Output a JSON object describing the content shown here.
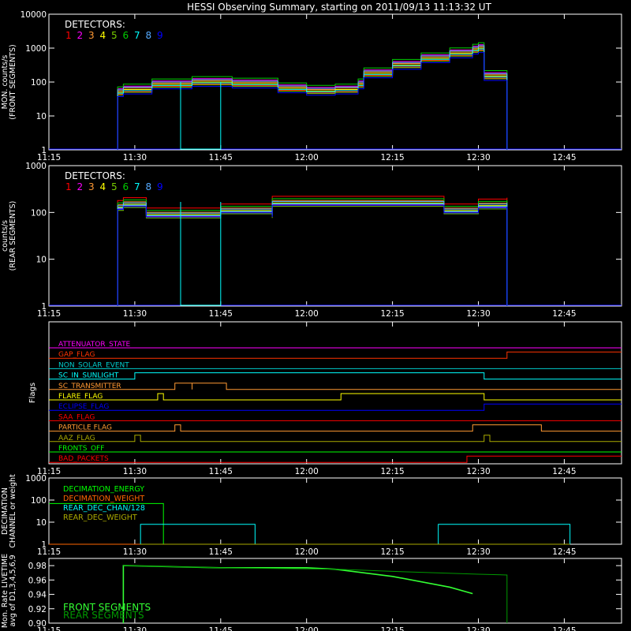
{
  "title": "HESSI Observing Summary, starting on 2011/09/13 11:13:32 UT",
  "colors": {
    "background": "#000000",
    "axis": "#ffffff",
    "detectors": [
      "#ff0000",
      "#ff00ff",
      "#ff9933",
      "#ffff00",
      "#77cc00",
      "#00cc00",
      "#00ffff",
      "#55aaff",
      "#0000ff"
    ]
  },
  "time_axis": {
    "start": "11:15",
    "end": "12:55",
    "ticks": [
      "11:15",
      "11:30",
      "11:45",
      "12:00",
      "12:15",
      "12:30",
      "12:45"
    ]
  },
  "detectors_label": "DETECTORS:",
  "detector_numbers": [
    "1",
    "2",
    "3",
    "4",
    "5",
    "6",
    "7",
    "8",
    "9"
  ],
  "chart_data": [
    {
      "panel": "front",
      "type": "line",
      "ylabel": "MON. counts/s (FRONT SEGMENTS)",
      "ylabel_lines": [
        "MON. counts/s",
        "(FRONT SEGMENTS)"
      ],
      "yscale": "log",
      "ylim": [
        1,
        10000
      ],
      "yticks": [
        "1",
        "10",
        "100",
        "1000",
        "10000"
      ],
      "envelope": {
        "x": [
          "11:27",
          "11:27",
          "11:28",
          "11:33",
          "11:40",
          "11:47",
          "11:55",
          "12:00",
          "12:05",
          "12:09",
          "12:10",
          "12:15",
          "12:20",
          "12:25",
          "12:29",
          "12:30",
          "12:31",
          "12:31",
          "12:35",
          "12:35"
        ],
        "y": [
          1,
          50,
          60,
          85,
          100,
          90,
          65,
          55,
          60,
          85,
          180,
          320,
          500,
          700,
          900,
          1000,
          1000,
          150,
          130,
          1
        ]
      },
      "detector_offsets": [
        -0.06,
        0.1,
        0.04,
        0.0,
        -0.08,
        0.16,
        -0.03,
        0.07,
        -0.13
      ],
      "detector7_gap": [
        "11:38",
        "11:45"
      ]
    },
    {
      "panel": "rear",
      "type": "line",
      "ylabel": "counts/s (REAR SEGMENTS)",
      "ylabel_lines": [
        "counts/s",
        "(REAR SEGMENTS)"
      ],
      "yscale": "log",
      "ylim": [
        1,
        1000
      ],
      "yticks": [
        "1",
        "10",
        "100",
        "1000"
      ],
      "envelope": {
        "x": [
          "11:27",
          "11:27",
          "11:28",
          "11:32",
          "11:32",
          "11:45",
          "11:54",
          "11:54",
          "12:24",
          "12:24",
          "12:30",
          "12:35",
          "12:35"
        ],
        "y": [
          1,
          130,
          150,
          140,
          90,
          110,
          90,
          160,
          160,
          110,
          140,
          150,
          1
        ]
      },
      "detector_offsets": [
        0.14,
        -0.03,
        0.05,
        0.0,
        -0.07,
        0.09,
        -0.02,
        0.03,
        -0.05
      ],
      "detector7_gap": [
        "11:38",
        "11:45"
      ]
    },
    {
      "panel": "flags",
      "type": "line",
      "ylabel": "Flags",
      "flags": [
        {
          "label": "ATTENUATOR_STATE",
          "color": "#ff00ff",
          "transitions": []
        },
        {
          "label": "SAA_FLAG_GAP_FLAG",
          "display": "GAP_FLAG",
          "color": "#ff3300",
          "transitions": [
            [
              "12:35",
              1
            ]
          ]
        },
        {
          "label": "NON_SOLAR_EVENT",
          "color": "#00cccc",
          "transitions": []
        },
        {
          "label": "SC_IN_SUNLIGHT",
          "color": "#00ffff",
          "transitions": [
            [
              "11:30",
              1
            ],
            [
              "12:31",
              0
            ]
          ]
        },
        {
          "label": "SC_TRANSMITTER",
          "color": "#ff9933",
          "transitions": [
            [
              "11:37",
              1
            ],
            [
              "11:40",
              0
            ],
            [
              "11:40",
              1
            ],
            [
              "11:46",
              0
            ]
          ]
        },
        {
          "label": "FLARE_FLAG",
          "color": "#ffff00",
          "transitions": [
            [
              "11:34",
              1
            ],
            [
              "11:35",
              0
            ],
            [
              "12:06",
              1
            ],
            [
              "12:31",
              0
            ]
          ]
        },
        {
          "label": "ECLIPSE_FLAG",
          "color": "#0000ff",
          "transitions": [
            [
              "11:30",
              0
            ],
            [
              "12:31",
              1
            ]
          ]
        },
        {
          "label": "SAA_FLAG",
          "color": "#ff0000",
          "transitions": []
        },
        {
          "label": "PARTICLE FLAG",
          "color": "#ff9933",
          "transitions": [
            [
              "11:37",
              1
            ],
            [
              "11:38",
              0
            ],
            [
              "12:29",
              1
            ],
            [
              "12:41",
              0
            ]
          ]
        },
        {
          "label": "AAZ_FLAG",
          "color": "#aaaa00",
          "transitions": [
            [
              "11:30",
              1
            ],
            [
              "11:31",
              0
            ],
            [
              "12:31",
              1
            ],
            [
              "12:32",
              0
            ]
          ]
        },
        {
          "label": "FRONTS_OFF",
          "color": "#00ff00",
          "transitions": []
        },
        {
          "label": "BAD_PACKETS",
          "color": "#ff0000",
          "transitions": [
            [
              "12:28",
              1
            ]
          ]
        }
      ]
    },
    {
      "panel": "decimation",
      "type": "line",
      "ylabel": "DECIMATION CHANNEL or weight",
      "ylabel_lines": [
        "DECIMATION",
        "CHANNEL or weight"
      ],
      "yscale": "log",
      "ylim": [
        1,
        1000
      ],
      "yticks": [
        "1",
        "10",
        "100",
        "1000"
      ],
      "series": [
        {
          "name": "DECIMATION_ENERGY",
          "color": "#00ff00",
          "x": [
            "11:15",
            "11:35",
            "11:35",
            "11:51"
          ],
          "y": [
            70,
            70,
            1,
            1
          ]
        },
        {
          "name": "DECIMATION_WEIGHT",
          "color": "#ff6600",
          "x": [
            "11:15",
            "11:35"
          ],
          "y": [
            1,
            1
          ]
        },
        {
          "name": "REAR_DEC_CHAN/128",
          "color": "#00ffff",
          "x": [
            "11:31",
            "11:31",
            "11:51",
            "11:51",
            "12:23",
            "12:23",
            "12:46",
            "12:46"
          ],
          "y": [
            1,
            8,
            8,
            1,
            1,
            8,
            8,
            1
          ]
        },
        {
          "name": "REAR_DEC_WEIGHT",
          "color": "#aaaa00",
          "x": [
            "11:31",
            "11:51",
            "12:23",
            "12:46"
          ],
          "y": [
            1,
            1,
            1,
            1
          ]
        }
      ]
    },
    {
      "panel": "livetime",
      "type": "line",
      "ylabel": "Mon. Rate LIVETIME avg of D1,3,4,5,6,9",
      "ylabel_lines": [
        "Mon. Rate LIVETIME",
        "avg of D1,3,4,5,6,9"
      ],
      "ylim": [
        0.9,
        0.99
      ],
      "yticks": [
        "0.90",
        "0.92",
        "0.94",
        "0.96",
        "0.98"
      ],
      "series": [
        {
          "name": "FRONT SEGMENTS",
          "color": "#33ff33",
          "x": [
            "11:28",
            "11:28",
            "11:45",
            "12:00",
            "12:05",
            "12:15",
            "12:25",
            "12:29"
          ],
          "y": [
            0.9,
            0.98,
            0.977,
            0.977,
            0.975,
            0.965,
            0.95,
            0.941
          ]
        },
        {
          "name": "REAR SEGMENTS",
          "color": "#009900",
          "x": [
            "11:28",
            "11:45",
            "12:05",
            "12:15",
            "12:30",
            "12:35",
            "12:35"
          ],
          "y": [
            0.98,
            0.977,
            0.975,
            0.972,
            0.968,
            0.967,
            0.9
          ]
        }
      ]
    }
  ]
}
